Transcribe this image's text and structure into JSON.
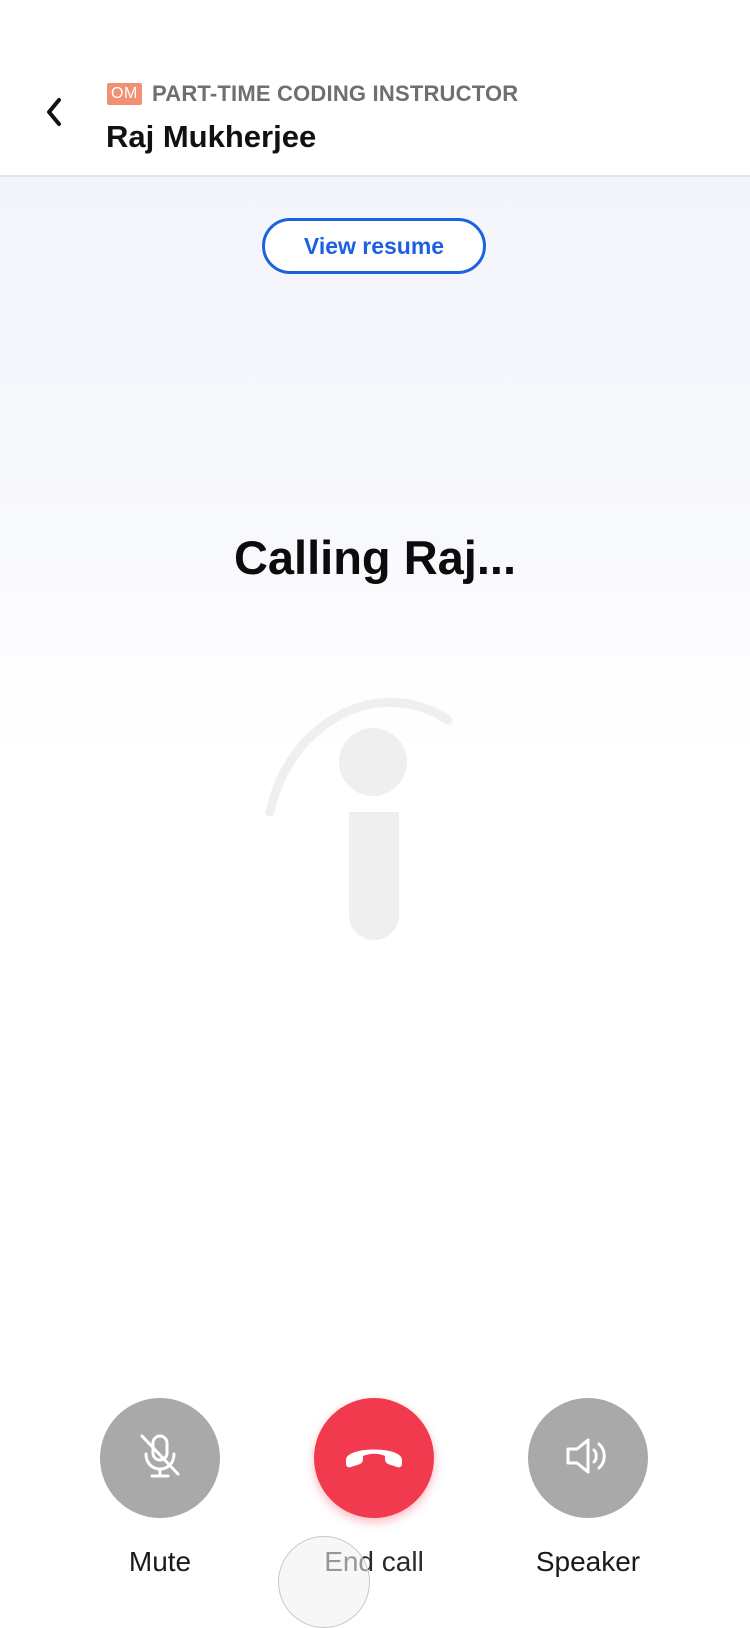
{
  "header": {
    "company_badge": "OM",
    "job_title": "PART-TIME CODING INSTRUCTOR",
    "candidate_name": "Raj Mukherjee"
  },
  "call": {
    "view_resume_label": "View resume",
    "status_text": "Calling Raj..."
  },
  "actions": {
    "mute_label": "Mute",
    "end_call_label": "End call",
    "speaker_label": "Speaker"
  },
  "colors": {
    "accent_blue": "#1c62df",
    "end_call_red": "#f23a4f",
    "control_gray": "#a9a9a9",
    "badge_orange": "#f29074"
  },
  "icons": {
    "back": "chevron-left-icon",
    "mute": "microphone-off-icon",
    "end_call": "phone-hangup-icon",
    "speaker": "speaker-volume-icon",
    "watermark": "indeed-logo-icon"
  }
}
